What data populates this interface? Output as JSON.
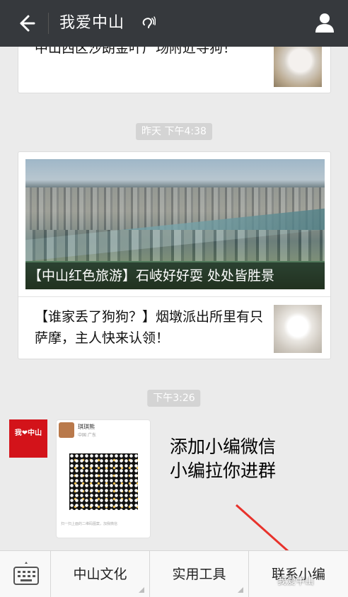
{
  "header": {
    "title": "我爱中山"
  },
  "feed": {
    "card1": {
      "text": "中山西区沙朗金叶广场附近寻狗！"
    },
    "timestamp1": "昨天 下午4:38",
    "card2": {
      "cover_caption": "【中山红色旅游】石岐好好耍 处处皆胜景",
      "sub_text": "【谁家丢了狗狗？】烟墩派出所里有只萨摩，主人快来认领！"
    },
    "timestamp2": "下午3:26",
    "message": {
      "avatar_text": "我❤中山",
      "qr_name": "琪琪熊",
      "qr_location": "中国 广东",
      "qr_footer": "扫一扫上面的二维码图案，加我微信",
      "promo_line1": "添加小编微信",
      "promo_line2": "小编拉你进群"
    }
  },
  "menu": {
    "items": [
      "中山文化",
      "实用工具",
      "联系小编"
    ]
  },
  "watermark": "我爱中山",
  "colors": {
    "header_bg": "#36393d",
    "chat_bg": "#ebebeb",
    "arrow": "#e8322b"
  }
}
